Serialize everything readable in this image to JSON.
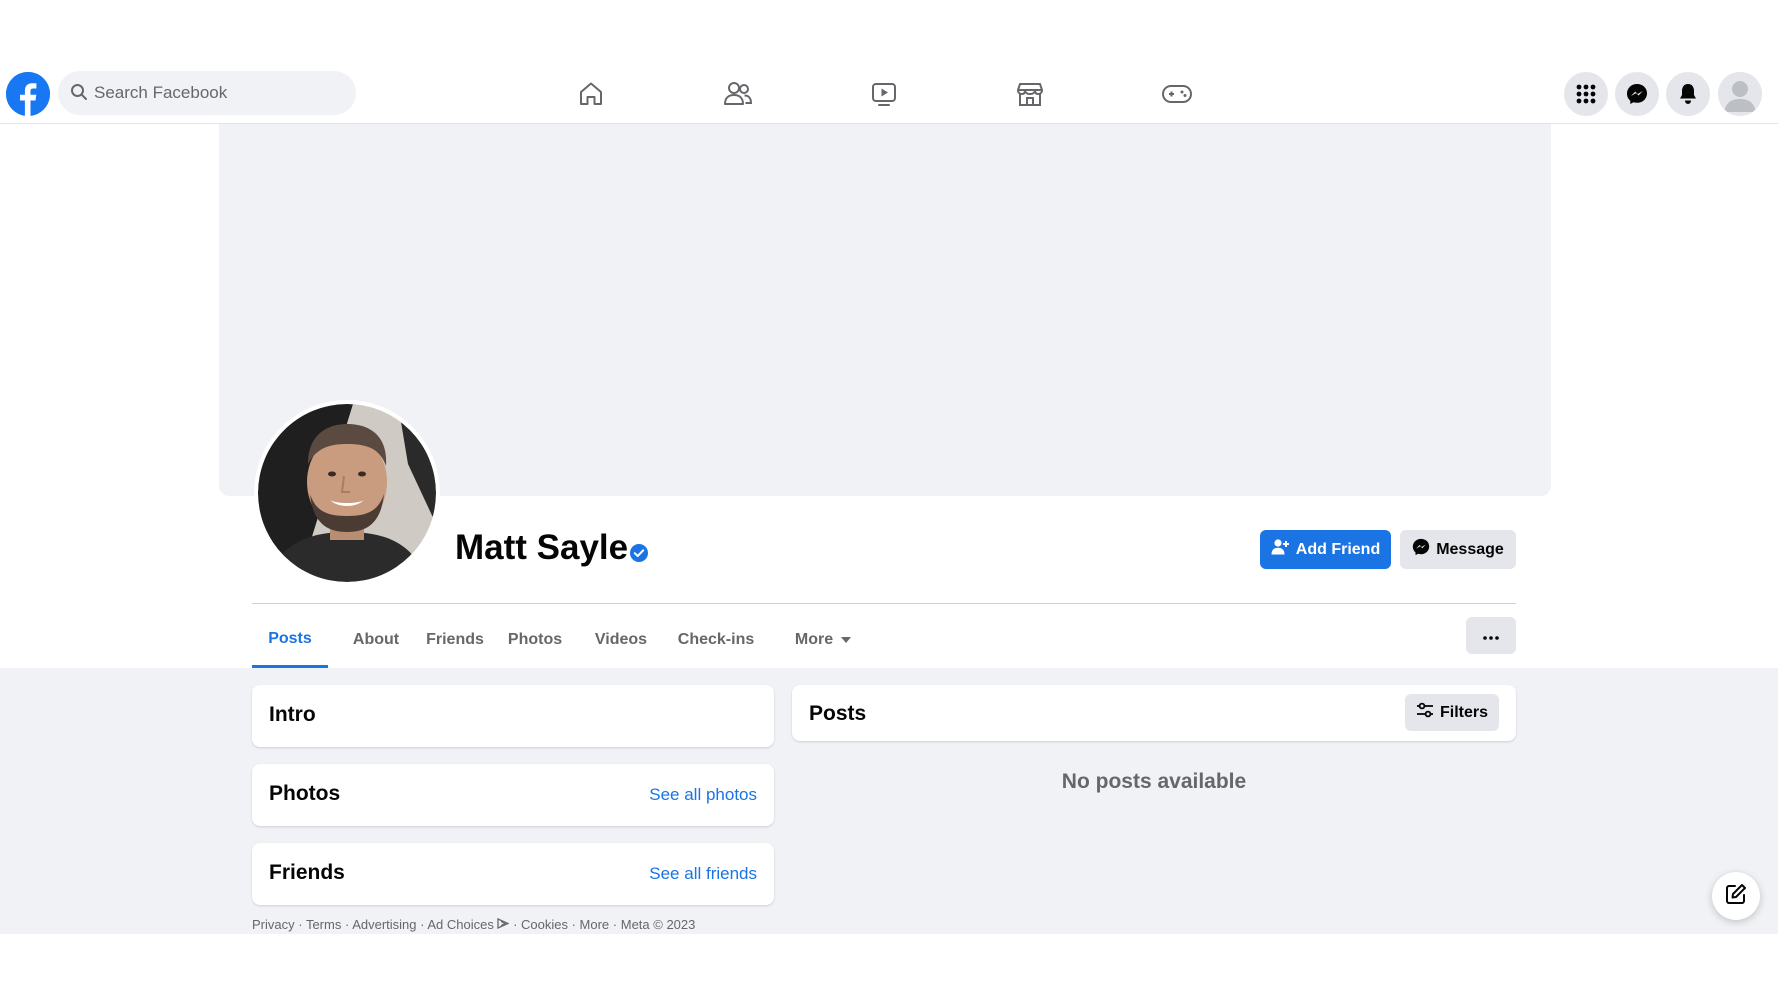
{
  "topbar": {
    "search_placeholder": "Search Facebook",
    "nav": [
      "home-icon",
      "friends-icon",
      "watch-icon",
      "marketplace-icon",
      "gaming-icon"
    ],
    "right": [
      "menu-grid-icon",
      "messenger-icon",
      "notifications-icon",
      "account-avatar"
    ]
  },
  "profile": {
    "name": "Matt Sayle",
    "verified": true,
    "add_friend_label": "Add Friend",
    "message_label": "Message"
  },
  "tabs": [
    {
      "label": "Posts",
      "active": true
    },
    {
      "label": "About",
      "active": false
    },
    {
      "label": "Friends",
      "active": false
    },
    {
      "label": "Photos",
      "active": false
    },
    {
      "label": "Videos",
      "active": false
    },
    {
      "label": "Check-ins",
      "active": false
    },
    {
      "label": "More",
      "active": false
    }
  ],
  "left_cards": {
    "intro_title": "Intro",
    "photos_title": "Photos",
    "photos_link": "See all photos",
    "friends_title": "Friends",
    "friends_link": "See all friends"
  },
  "posts": {
    "title": "Posts",
    "filters_label": "Filters",
    "empty_text": "No posts available"
  },
  "footer": {
    "items": [
      "Privacy",
      "Terms",
      "Advertising",
      "Ad Choices",
      "Cookies",
      "More",
      "Meta © 2023"
    ]
  },
  "colors": {
    "brand_blue": "#1877f2",
    "link_blue": "#1b74e4",
    "page_gray": "#f0f2f5"
  }
}
